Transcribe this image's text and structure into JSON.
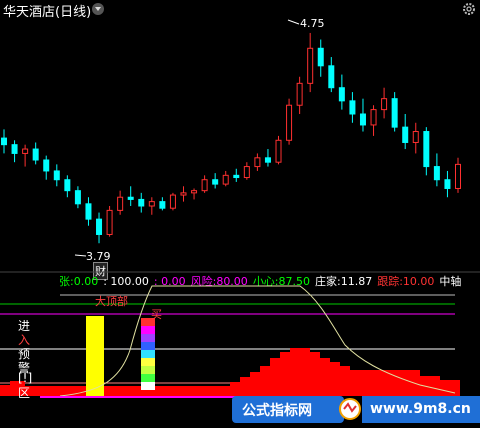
{
  "header": {
    "title": "华天酒店(日线)"
  },
  "price_chart": {
    "high_label": "4.75",
    "low_label": "3.79",
    "fin_marker": "财"
  },
  "readout": {
    "items": [
      {
        "label": "张:",
        "value": "0.00",
        "color": "#00ff00"
      },
      {
        "label": "",
        "value": ": 100.00",
        "color": "#ffffff"
      },
      {
        "label": "",
        "value": ": 0.00",
        "color": "#ff00ff"
      },
      {
        "label": "风险:",
        "value": "80.00",
        "color": "#ff00ff"
      },
      {
        "label": "小心:",
        "value": "87.50",
        "color": "#00ff00"
      },
      {
        "label": "庄家:",
        "value": "11.87",
        "color": "#ffffff"
      },
      {
        "label": "跟踪:",
        "value": "10.00",
        "color": "#ff3333"
      },
      {
        "label": "中轴",
        "value": "",
        "color": "#ffffff"
      }
    ]
  },
  "indicator": {
    "top_label": "大顶部",
    "buy_label": "买",
    "left_labels": [
      "进",
      "入",
      "预",
      "警",
      "[!]",
      "区"
    ]
  },
  "watermark": {
    "text": "公式指标网",
    "url": "www.9m8.cn"
  },
  "colors": {
    "up": "#ff3030",
    "down": "#00ffff",
    "volume": "#ff0000",
    "yellow": "#ffff00"
  },
  "chart_data": {
    "type": "candlestick",
    "title": "华天酒店(日线)",
    "price_high": 4.75,
    "price_low": 3.79,
    "ylim": [
      3.75,
      4.8
    ],
    "candles": [
      [
        4.27,
        4.31,
        4.2,
        4.24
      ],
      [
        4.24,
        4.26,
        4.16,
        4.2
      ],
      [
        4.2,
        4.24,
        4.14,
        4.22
      ],
      [
        4.22,
        4.25,
        4.15,
        4.17
      ],
      [
        4.17,
        4.19,
        4.08,
        4.12
      ],
      [
        4.12,
        4.15,
        4.05,
        4.08
      ],
      [
        4.08,
        4.1,
        4.0,
        4.03
      ],
      [
        4.03,
        4.05,
        3.95,
        3.97
      ],
      [
        3.97,
        4.0,
        3.87,
        3.9
      ],
      [
        3.9,
        3.93,
        3.79,
        3.83
      ],
      [
        3.83,
        3.96,
        3.82,
        3.94
      ],
      [
        3.94,
        4.03,
        3.92,
        4.0
      ],
      [
        4.0,
        4.05,
        3.96,
        3.99
      ],
      [
        3.99,
        4.02,
        3.93,
        3.96
      ],
      [
        3.96,
        4.0,
        3.92,
        3.98
      ],
      [
        3.98,
        4.0,
        3.94,
        3.95
      ],
      [
        3.95,
        4.02,
        3.94,
        4.01
      ],
      [
        4.01,
        4.05,
        3.98,
        4.02
      ],
      [
        4.02,
        4.04,
        3.99,
        4.03
      ],
      [
        4.03,
        4.1,
        4.02,
        4.08
      ],
      [
        4.08,
        4.11,
        4.04,
        4.06
      ],
      [
        4.06,
        4.12,
        4.05,
        4.1
      ],
      [
        4.1,
        4.13,
        4.07,
        4.09
      ],
      [
        4.09,
        4.16,
        4.08,
        4.14
      ],
      [
        4.14,
        4.2,
        4.12,
        4.18
      ],
      [
        4.18,
        4.22,
        4.14,
        4.16
      ],
      [
        4.16,
        4.28,
        4.15,
        4.26
      ],
      [
        4.26,
        4.45,
        4.24,
        4.42
      ],
      [
        4.42,
        4.55,
        4.38,
        4.52
      ],
      [
        4.52,
        4.75,
        4.48,
        4.68
      ],
      [
        4.68,
        4.72,
        4.55,
        4.6
      ],
      [
        4.6,
        4.64,
        4.48,
        4.5
      ],
      [
        4.5,
        4.56,
        4.4,
        4.44
      ],
      [
        4.44,
        4.48,
        4.34,
        4.38
      ],
      [
        4.38,
        4.45,
        4.3,
        4.33
      ],
      [
        4.33,
        4.42,
        4.28,
        4.4
      ],
      [
        4.4,
        4.5,
        4.36,
        4.45
      ],
      [
        4.45,
        4.48,
        4.3,
        4.32
      ],
      [
        4.32,
        4.38,
        4.22,
        4.25
      ],
      [
        4.25,
        4.34,
        4.2,
        4.3
      ],
      [
        4.3,
        4.32,
        4.1,
        4.14
      ],
      [
        4.14,
        4.2,
        4.05,
        4.08
      ],
      [
        4.08,
        4.12,
        4.0,
        4.04
      ],
      [
        4.04,
        4.18,
        4.02,
        4.15
      ]
    ]
  }
}
